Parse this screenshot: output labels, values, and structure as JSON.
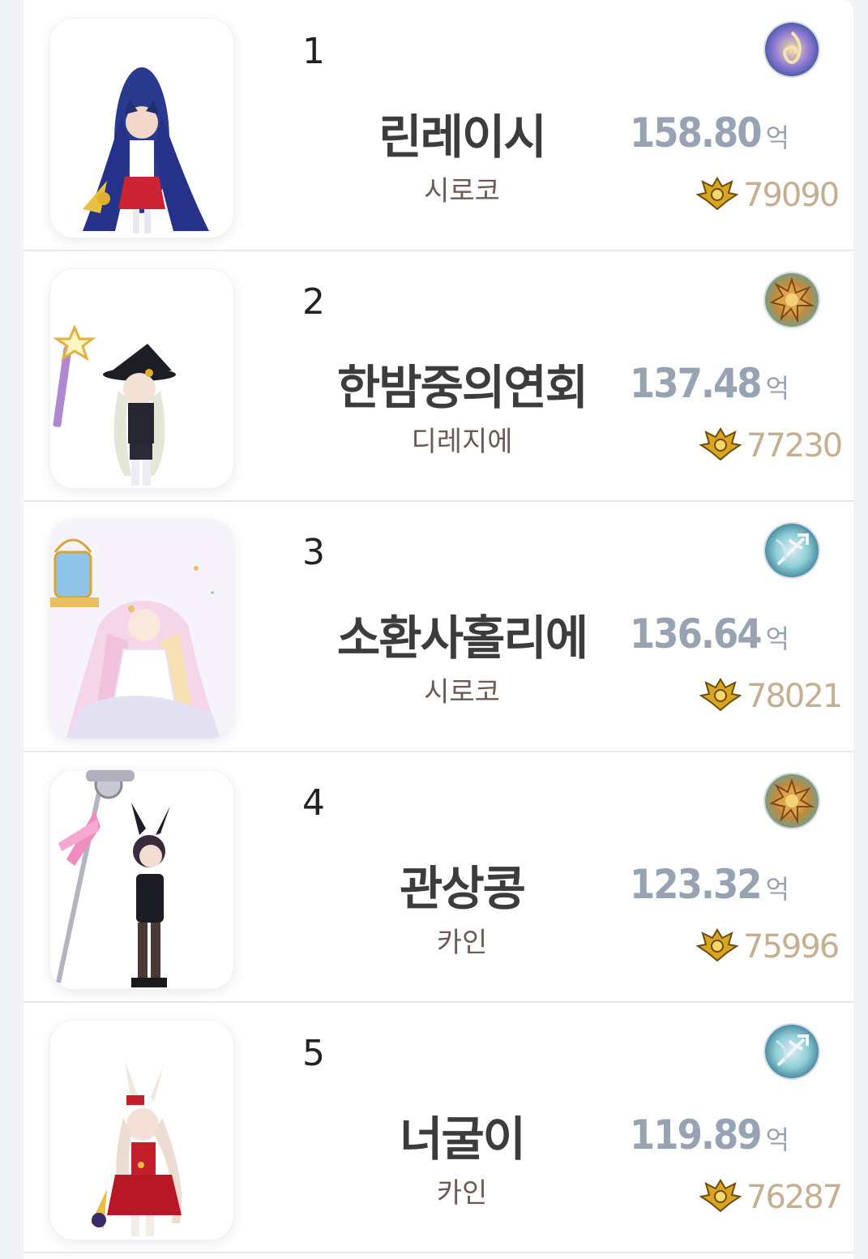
{
  "ranking": {
    "entries": [
      {
        "rank": "1",
        "name": "린레이시",
        "server": "시로코",
        "damage": "158.80",
        "unit": "억",
        "fame": "79090",
        "class_icon": "spiral-flame-icon",
        "icon_colors": [
          "#3b5fa8",
          "#e8b96a",
          "#8f7bd6"
        ]
      },
      {
        "rank": "2",
        "name": "한밤중의연회",
        "server": "디레지에",
        "damage": "137.48",
        "unit": "억",
        "fame": "77230",
        "class_icon": "sun-burst-icon",
        "icon_colors": [
          "#5aa3a0",
          "#e0a24a",
          "#f4d27a"
        ]
      },
      {
        "rank": "3",
        "name": "소환사홀리에",
        "server": "시로코",
        "damage": "136.64",
        "unit": "억",
        "fame": "78021",
        "class_icon": "trident-spirit-icon",
        "icon_colors": [
          "#2f6d8a",
          "#8fd0d8",
          "#dfe9f2"
        ]
      },
      {
        "rank": "4",
        "name": "관상콩",
        "server": "카인",
        "damage": "123.32",
        "unit": "억",
        "fame": "75996",
        "class_icon": "sun-burst-icon",
        "icon_colors": [
          "#5aa3a0",
          "#e0a24a",
          "#f4d27a"
        ]
      },
      {
        "rank": "5",
        "name": "너굴이",
        "server": "카인",
        "damage": "119.89",
        "unit": "억",
        "fame": "76287",
        "class_icon": "trident-spirit-icon",
        "icon_colors": [
          "#2f6d8a",
          "#8fd0d8",
          "#dfe9f2"
        ]
      }
    ]
  },
  "colors": {
    "damage_text": "#97a3b3",
    "fame_text": "#c4af90",
    "name_text": "#3c3c3c",
    "server_text": "#6e5a55",
    "crest_gold": "#d9a520"
  }
}
